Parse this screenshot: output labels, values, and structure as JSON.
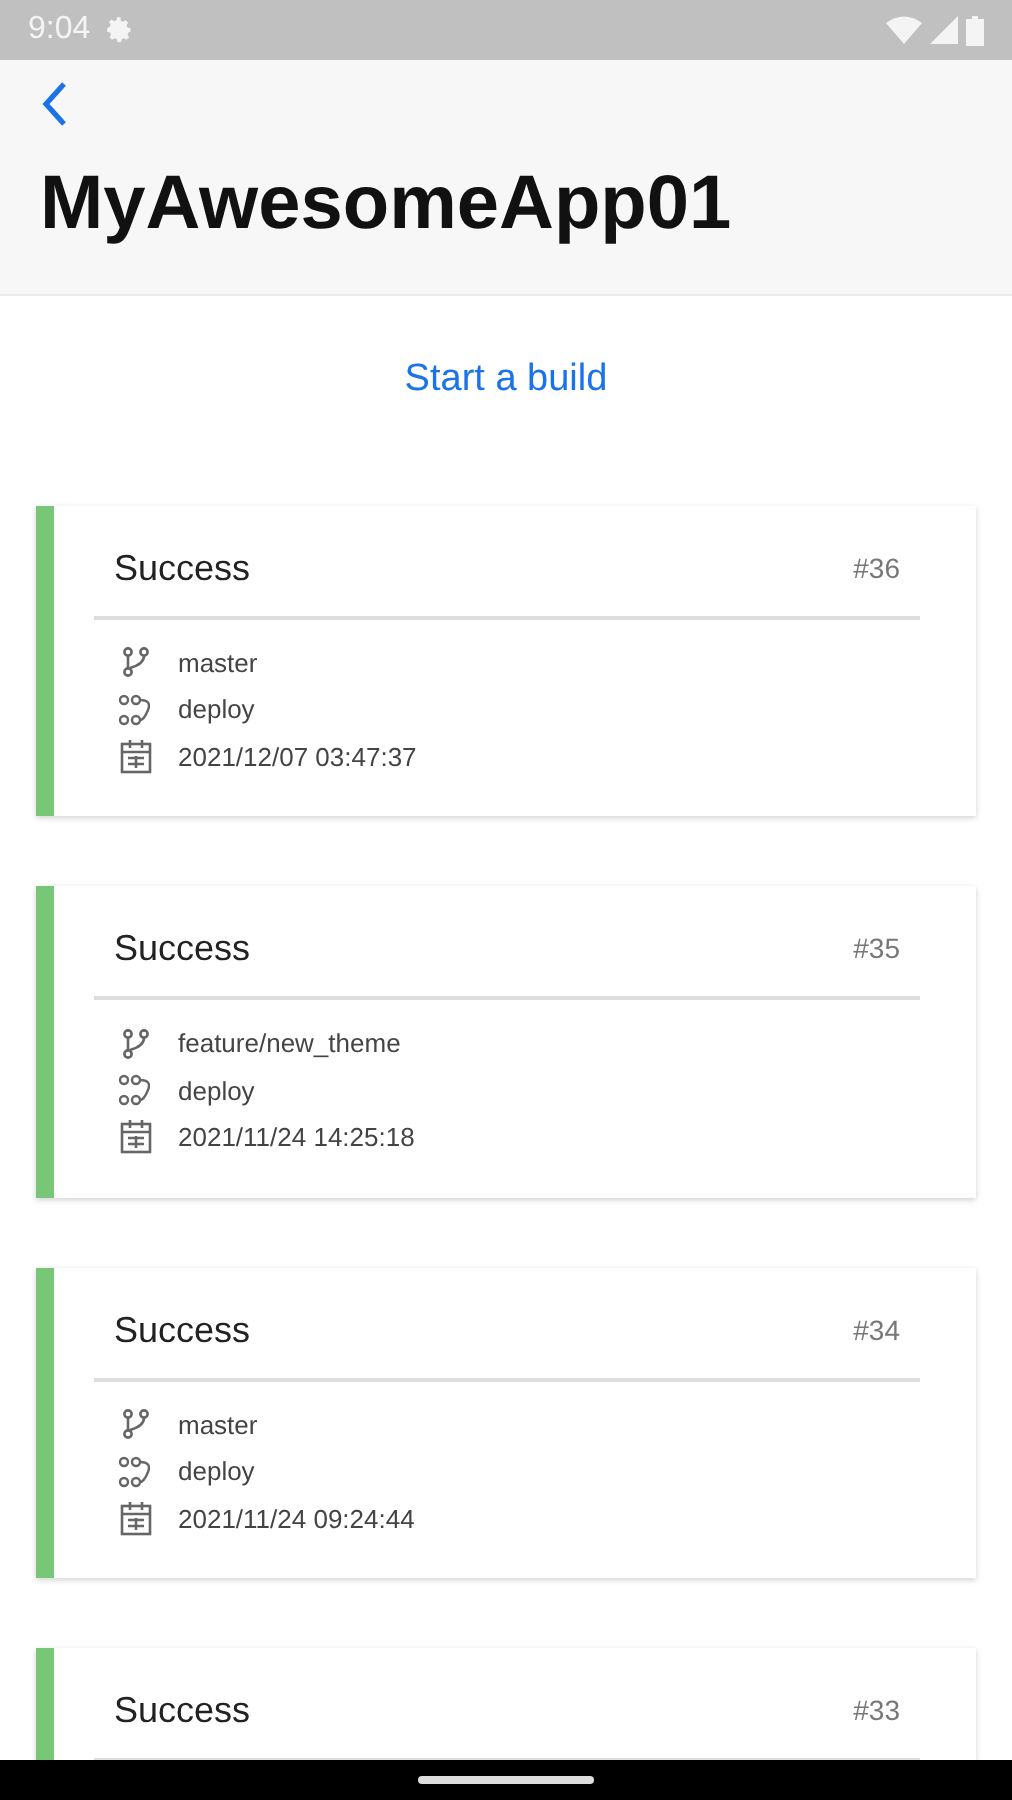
{
  "status_bar": {
    "time": "9:04"
  },
  "header": {
    "title": "MyAwesomeApp01"
  },
  "start_build": "Start a build",
  "builds": [
    {
      "status": "Success",
      "number": "#36",
      "color": "#77c777",
      "branch": "master",
      "workflow": "deploy",
      "date": "2021/12/07 03:47:37"
    },
    {
      "status": "Success",
      "number": "#35",
      "color": "#77c777",
      "branch": "feature/new_theme",
      "workflow": "deploy",
      "date": "2021/11/24 14:25:18"
    },
    {
      "status": "Success",
      "number": "#34",
      "color": "#77c777",
      "branch": "master",
      "workflow": "deploy",
      "date": "2021/11/24 09:24:44"
    },
    {
      "status": "Success",
      "number": "#33",
      "color": "#77c777"
    }
  ]
}
